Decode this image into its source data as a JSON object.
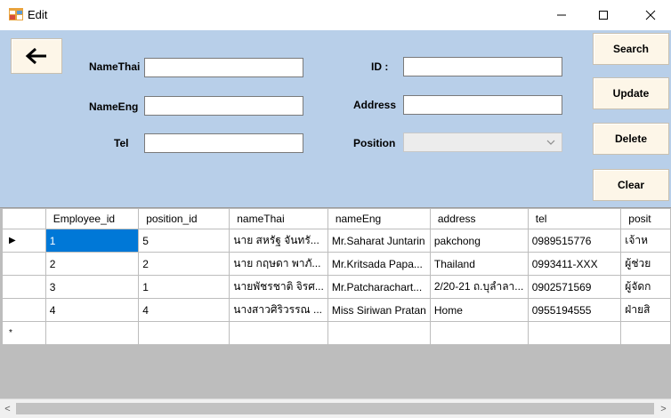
{
  "window": {
    "title": "Edit",
    "minimize": "—",
    "maximize": "☐",
    "close": "✕"
  },
  "form": {
    "back_icon": "arrow-left",
    "labels": {
      "name_thai": "NameThai",
      "name_eng": "NameEng",
      "tel": "Tel",
      "id": "ID :",
      "address": "Address",
      "position": "Position"
    },
    "values": {
      "name_thai": "",
      "name_eng": "",
      "tel": "",
      "id": "",
      "address": "",
      "position": ""
    }
  },
  "buttons": {
    "search": "Search",
    "update": "Update",
    "delete": "Delete",
    "clear": "Clear"
  },
  "grid": {
    "columns": [
      "Employee_id",
      "position_id",
      "nameThai",
      "nameEng",
      "address",
      "tel",
      "posit"
    ],
    "rows": [
      [
        "1",
        "5",
        "นาย สหรัฐ จันทรั...",
        "Mr.Saharat Juntarin",
        "pakchong",
        "0989515776",
        "เจ้าห"
      ],
      [
        "2",
        "2",
        "นาย กฤษดา พาภั...",
        "Mr.Kritsada Papa...",
        "Thailand",
        "0993411-XXX",
        "ผู้ช่วย"
      ],
      [
        "3",
        "1",
        "นายพัชรชาติ จิรศ...",
        "Mr.Patcharachart...",
        "2/20-21 ถ.บุลำลา...",
        "0902571569",
        "ผู้จัดก"
      ],
      [
        "4",
        "4",
        "นางสาวศิริวรรณ ...",
        "Miss Siriwan Pratan",
        "Home",
        "0955194555",
        "ฝ่ายสิ"
      ]
    ],
    "new_row_marker": "*",
    "current_row_marker": "▶"
  },
  "scrollbar": {
    "left": "<",
    "right": ">"
  }
}
